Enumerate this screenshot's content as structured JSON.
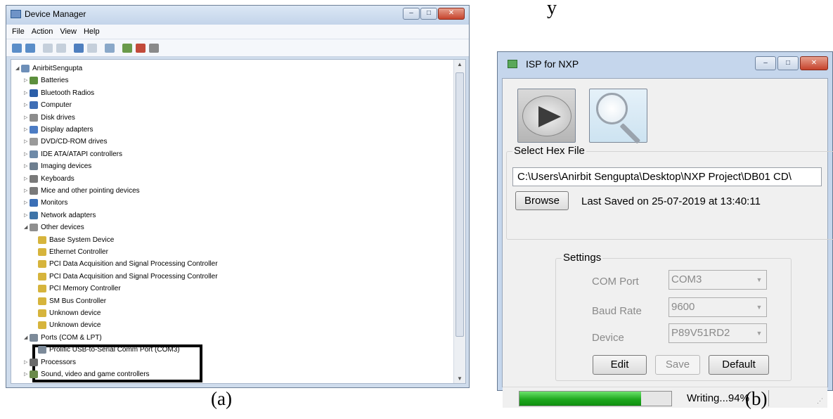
{
  "stray_char": "y",
  "captions": {
    "a": "(a)",
    "b": "(b)"
  },
  "device_manager": {
    "title": "Device Manager",
    "menu": [
      "File",
      "Action",
      "View",
      "Help"
    ],
    "tree": [
      {
        "label": "AnirbitSengupta",
        "depth": 0,
        "expanded": true,
        "icon_color": "#6d8fb8"
      },
      {
        "label": "Batteries",
        "depth": 1,
        "expanded": false,
        "icon_color": "#5c8f3d"
      },
      {
        "label": "Bluetooth Radios",
        "depth": 1,
        "expanded": false,
        "icon_color": "#2c5fa8"
      },
      {
        "label": "Computer",
        "depth": 1,
        "expanded": false,
        "icon_color": "#3f6eb5"
      },
      {
        "label": "Disk drives",
        "depth": 1,
        "expanded": false,
        "icon_color": "#8c8c8c"
      },
      {
        "label": "Display adapters",
        "depth": 1,
        "expanded": false,
        "icon_color": "#4c7cc4"
      },
      {
        "label": "DVD/CD-ROM drives",
        "depth": 1,
        "expanded": false,
        "icon_color": "#9a9a9a"
      },
      {
        "label": "IDE ATA/ATAPI controllers",
        "depth": 1,
        "expanded": false,
        "icon_color": "#6e8aa8"
      },
      {
        "label": "Imaging devices",
        "depth": 1,
        "expanded": false,
        "icon_color": "#6e7f90"
      },
      {
        "label": "Keyboards",
        "depth": 1,
        "expanded": false,
        "icon_color": "#7a7a7a"
      },
      {
        "label": "Mice and other pointing devices",
        "depth": 1,
        "expanded": false,
        "icon_color": "#7a7a7a"
      },
      {
        "label": "Monitors",
        "depth": 1,
        "expanded": false,
        "icon_color": "#3b6fb6"
      },
      {
        "label": "Network adapters",
        "depth": 1,
        "expanded": false,
        "icon_color": "#3f74a8"
      },
      {
        "label": "Other devices",
        "depth": 1,
        "expanded": true,
        "icon_color": "#8f8f8f"
      },
      {
        "label": "Base System Device",
        "depth": 2,
        "icon_color": "#d6b43c"
      },
      {
        "label": "Ethernet Controller",
        "depth": 2,
        "icon_color": "#d6b43c"
      },
      {
        "label": "PCI Data Acquisition and Signal Processing Controller",
        "depth": 2,
        "icon_color": "#d6b43c"
      },
      {
        "label": "PCI Data Acquisition and Signal Processing Controller",
        "depth": 2,
        "icon_color": "#d6b43c"
      },
      {
        "label": "PCI Memory Controller",
        "depth": 2,
        "icon_color": "#d6b43c"
      },
      {
        "label": "SM Bus Controller",
        "depth": 2,
        "icon_color": "#d6b43c"
      },
      {
        "label": "Unknown device",
        "depth": 2,
        "icon_color": "#d6b43c"
      },
      {
        "label": "Unknown device",
        "depth": 2,
        "icon_color": "#d6b43c"
      },
      {
        "label": "Ports (COM & LPT)",
        "depth": 1,
        "expanded": true,
        "icon_color": "#7c8a99"
      },
      {
        "label": "Prolific USB-to-Serial Comm Port (COM3)",
        "depth": 2,
        "icon_color": "#7c8a99"
      },
      {
        "label": "Processors",
        "depth": 1,
        "expanded": false,
        "icon_color": "#6a6a6a"
      },
      {
        "label": "Sound, video and game controllers",
        "depth": 1,
        "expanded": false,
        "icon_color": "#6a8a4a"
      }
    ]
  },
  "isp": {
    "title": "ISP for NXP",
    "hex_legend": "Select Hex File",
    "hex_path": "C:\\Users\\Anirbit Sengupta\\Desktop\\NXP Project\\DB01 CD\\",
    "browse_label": "Browse",
    "last_saved": "Last Saved on 25-07-2019 at 13:40:11",
    "settings_legend": "Settings",
    "com_port_label": "COM Port",
    "com_port_value": "COM3",
    "baud_rate_label": "Baud Rate",
    "baud_rate_value": "9600",
    "device_label": "Device",
    "device_value": "P89V51RD2",
    "edit_label": "Edit",
    "save_label": "Save",
    "default_label": "Default",
    "status_text": "Writing...94%",
    "progress": 0.8
  }
}
